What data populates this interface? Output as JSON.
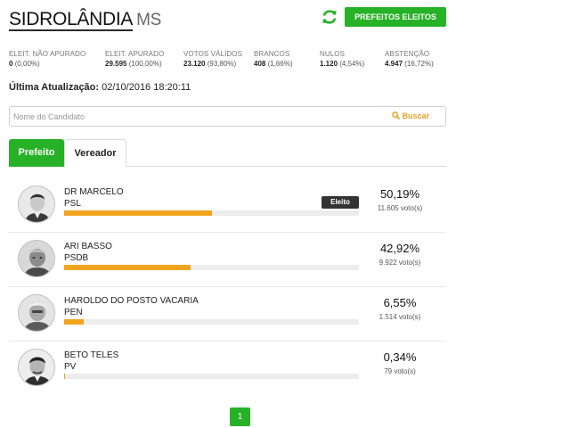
{
  "header": {
    "city": "SIDROLÂNDIA",
    "state": "MS",
    "refresh_icon": "refresh-icon",
    "prefeitos_button": "PREFEITOS ELEITOS"
  },
  "stats": [
    {
      "label": "ELEIT. NÃO APURADO",
      "value": "0",
      "pct": "(0,00%)"
    },
    {
      "label": "ELEIT. APURADO",
      "value": "29.595",
      "pct": "(100,00%)"
    },
    {
      "label": "VOTOS VÁLIDOS",
      "value": "23.120",
      "pct": "(93,80%)"
    },
    {
      "label": "BRANCOS",
      "value": "408",
      "pct": "(1,66%)"
    },
    {
      "label": "NULOS",
      "value": "1.120",
      "pct": "(4,54%)"
    },
    {
      "label": "ABSTENÇÃO",
      "value": "4.947",
      "pct": "(16,72%)"
    }
  ],
  "update": {
    "label": "Última Atualização:",
    "value": "02/10/2016 18:20:11"
  },
  "search": {
    "placeholder": "Nome do Candidato",
    "button": "Buscar"
  },
  "tabs": [
    {
      "label": "Prefeito",
      "active": true
    },
    {
      "label": "Vereador",
      "active": false
    }
  ],
  "candidates": [
    {
      "name": "DR MARCELO",
      "party": "PSL",
      "percent": "50,19%",
      "share": 0.5019,
      "votes": "11.605 voto(s)",
      "badge": "Eleito"
    },
    {
      "name": "ARI BASSO",
      "party": "PSDB",
      "percent": "42,92%",
      "share": 0.4292,
      "votes": "9.922 voto(s)",
      "badge": ""
    },
    {
      "name": "HAROLDO DO POSTO VACARIA",
      "party": "PEN",
      "percent": "6,55%",
      "share": 0.0655,
      "votes": "1.514 voto(s)",
      "badge": ""
    },
    {
      "name": "BETO TELES",
      "party": "PV",
      "percent": "0,34%",
      "share": 0.0034,
      "votes": "79 voto(s)",
      "badge": ""
    }
  ],
  "pagination": {
    "current": "1"
  },
  "colors": {
    "accent": "#27b127",
    "bar": "#f1a51f",
    "search_button": "#e6a024"
  }
}
